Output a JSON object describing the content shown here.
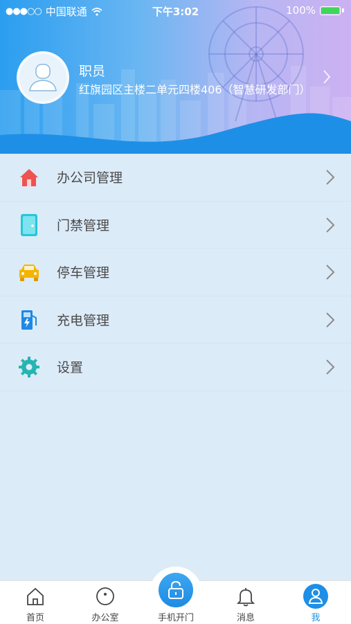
{
  "status_bar": {
    "signal_dots": "●●●○○",
    "carrier": "中国联通",
    "time": "下午3:02",
    "battery": "100%"
  },
  "profile": {
    "role": "职员",
    "address": "红旗园区主楼二单元四楼406（智慧研发部门）"
  },
  "menu": [
    {
      "label": "办公司管理",
      "icon": "house-icon",
      "color": "#ef5350"
    },
    {
      "label": "门禁管理",
      "icon": "door-icon",
      "color": "#26c6da"
    },
    {
      "label": "停车管理",
      "icon": "car-icon",
      "color": "#f5b400"
    },
    {
      "label": "充电管理",
      "icon": "charging-station-icon",
      "color": "#1e88e5"
    },
    {
      "label": "设置",
      "icon": "gear-icon",
      "color": "#26b5b0"
    }
  ],
  "tabs": [
    {
      "label": "首页",
      "icon": "home-icon"
    },
    {
      "label": "办公室",
      "icon": "circle-dot-icon"
    },
    {
      "label": "手机开门",
      "icon": "unlock-icon"
    },
    {
      "label": "消息",
      "icon": "bell-icon"
    },
    {
      "label": "我",
      "icon": "person-icon",
      "active": true
    }
  ],
  "colors": {
    "accent": "#1e8fe6",
    "header_start": "#2b9ef0",
    "header_end": "#cdb1f2",
    "background": "#dcebf8"
  }
}
